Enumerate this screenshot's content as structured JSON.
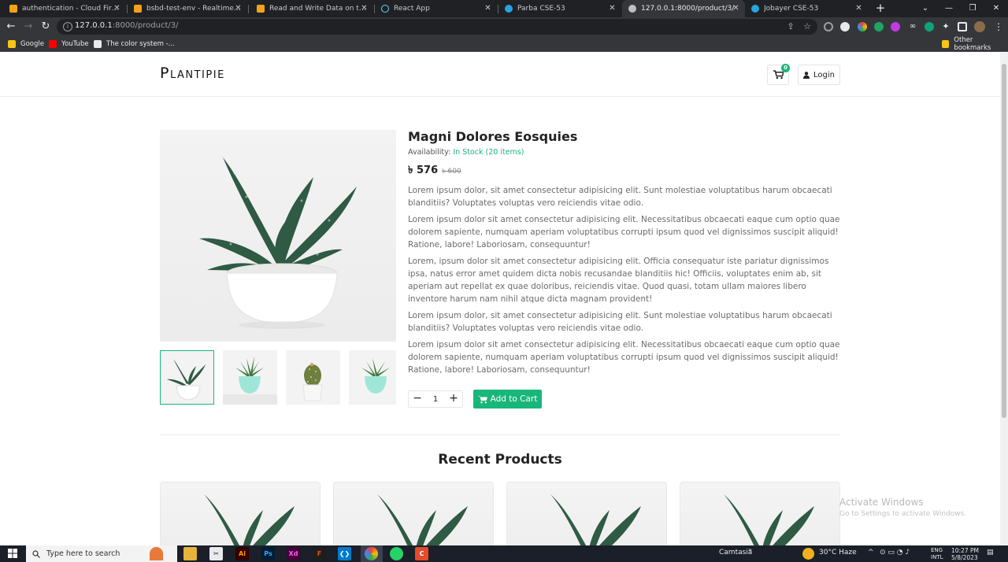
{
  "browser": {
    "tabs": [
      {
        "label": "authentication - Cloud Firestore",
        "color": "#f4a21b"
      },
      {
        "label": "bsbd-test-env - Realtime Databa",
        "color": "#f4a21b"
      },
      {
        "label": "Read and Write Data on the Web",
        "color": "#f4a21b"
      },
      {
        "label": "React App",
        "color": "#61dafb"
      },
      {
        "label": "Parba CSE-53",
        "color": "#29a3e0"
      },
      {
        "label": "127.0.0.1:8000/product/3/",
        "color": "#bdc1c6"
      },
      {
        "label": "Jobayer CSE-53",
        "color": "#29a3e0"
      }
    ],
    "url_host": "127.0.0.1",
    "url_path": ":8000/product/3/",
    "bookmarks": [
      "Google",
      "YouTube",
      "The color system -...",
      "Other bookmarks"
    ]
  },
  "site": {
    "logo": "Plantipie",
    "cart_count": "0",
    "login_label": "Login"
  },
  "product": {
    "title": "Magni Dolores Eosquies",
    "availability_label": "Availability:",
    "availability_value": "In Stock (20 items)",
    "price": "৳ 576",
    "old_price": "৳ 600",
    "description": [
      "Lorem ipsum dolor, sit amet consectetur adipisicing elit. Sunt molestiae voluptatibus harum obcaecati blanditiis? Voluptates voluptas vero reiciendis vitae odio.",
      "Lorem ipsum dolor sit amet consectetur adipisicing elit. Necessitatibus obcaecati eaque cum optio quae dolorem sapiente, numquam aperiam voluptatibus corrupti ipsum quod vel dignissimos suscipit aliquid! Ratione, labore! Laboriosam, consequuntur!",
      "Lorem, ipsum dolor sit amet consectetur adipisicing elit. Officia consequatur iste pariatur dignissimos ipsa, natus error amet quidem dicta nobis recusandae blanditiis hic! Officiis, voluptates enim ab, sit aperiam aut repellat ex quae doloribus, reiciendis vitae. Quod quasi, totam ullam maiores libero inventore harum nam nihil atque dicta magnam provident!",
      "Lorem ipsum dolor, sit amet consectetur adipisicing elit. Sunt molestiae voluptatibus harum obcaecati blanditiis? Voluptates voluptas vero reiciendis vitae odio.",
      "Lorem ipsum dolor sit amet consectetur adipisicing elit. Necessitatibus obcaecati eaque cum optio quae dolorem sapiente, numquam aperiam voluptatibus corrupti ipsum quod vel dignissimos suscipit aliquid! Ratione, labore! Laboriosam, consequuntur!"
    ],
    "quantity": "1",
    "add_to_cart_label": "Add to Cart",
    "accent_color": "#19b67a"
  },
  "recent": {
    "title": "Recent Products"
  },
  "watermark": {
    "line1": "Activate Windows",
    "line2": "Go to Settings to activate Windows."
  },
  "taskbar": {
    "search_placeholder": "Type here to search",
    "camtasia_label": "Camtasia",
    "weather": "30°C  Haze",
    "lang_line1": "ENG",
    "lang_line2": "INTL",
    "time": "10:27 PM",
    "date": "5/8/2023"
  }
}
